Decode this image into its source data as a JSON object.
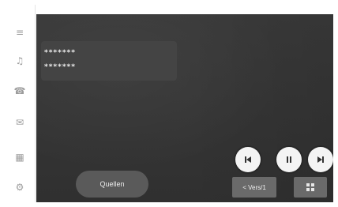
{
  "sidebar": {
    "items": [
      {
        "icon": "menu-icon",
        "glyph": "≡"
      },
      {
        "icon": "music-note-icon",
        "glyph": "♫"
      },
      {
        "icon": "phone-icon",
        "glyph": "☎"
      },
      {
        "icon": "message-icon",
        "glyph": "✉"
      },
      {
        "icon": "apps-grid-icon",
        "glyph": "▦"
      },
      {
        "icon": "settings-gear-icon",
        "glyph": "⚙"
      }
    ]
  },
  "track": {
    "line1": "*******",
    "line2": "*******"
  },
  "controls": {
    "prev_icon": "skip-previous-icon",
    "play_pause_icon": "pause-icon",
    "next_icon": "skip-next-icon"
  },
  "buttons": {
    "source_label": "Quellen",
    "version_label": "< Vers/1",
    "grid_icon": "grid-icon"
  },
  "colors": {
    "screen_bg": "#343434",
    "control_bg": "#f4f4f4",
    "button_bg": "#6a6a6a",
    "text_light": "#f2f2f2"
  }
}
